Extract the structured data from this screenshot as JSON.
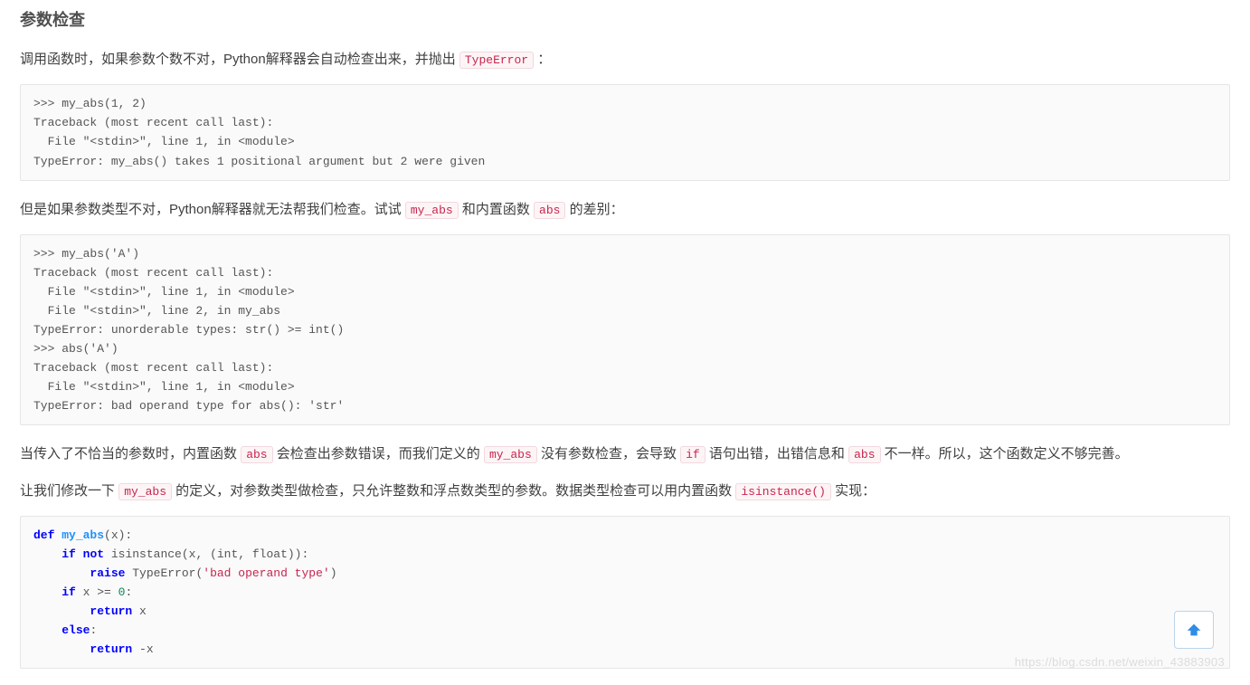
{
  "heading": "参数检查",
  "para1": {
    "t1": "调用函数时，如果参数个数不对，Python解释器会自动检查出来，并抛出",
    "code": "TypeError",
    "t2": "："
  },
  "code1": ">>> my_abs(1, 2)\nTraceback (most recent call last):\n  File \"<stdin>\", line 1, in <module>\nTypeError: my_abs() takes 1 positional argument but 2 were given",
  "para2": {
    "t1": "但是如果参数类型不对，Python解释器就无法帮我们检查。试试",
    "c1": "my_abs",
    "t2": "和内置函数",
    "c2": "abs",
    "t3": "的差别："
  },
  "code2": ">>> my_abs('A')\nTraceback (most recent call last):\n  File \"<stdin>\", line 1, in <module>\n  File \"<stdin>\", line 2, in my_abs\nTypeError: unorderable types: str() >= int()\n>>> abs('A')\nTraceback (most recent call last):\n  File \"<stdin>\", line 1, in <module>\nTypeError: bad operand type for abs(): 'str'",
  "para3": {
    "t1": "当传入了不恰当的参数时，内置函数",
    "c1": "abs",
    "t2": "会检查出参数错误，而我们定义的",
    "c2": "my_abs",
    "t3": "没有参数检查，会导致",
    "c3": "if",
    "t4": "语句出错，出错信息和",
    "c4": "abs",
    "t5": "不一样。所以，这个函数定义不够完善。"
  },
  "para4": {
    "t1": "让我们修改一下",
    "c1": "my_abs",
    "t2": "的定义，对参数类型做检查，只允许整数和浮点数类型的参数。数据类型检查可以用内置函数",
    "c2": "isinstance()",
    "t3": "实现："
  },
  "code3": {
    "kw_def": "def",
    "fn_name": "my_abs",
    "sig": "(x):",
    "kw_if": "if",
    "kw_not": "not",
    "isinstance_call": " isinstance(x, (int, float)):",
    "kw_raise": "raise",
    "typeerr": " TypeError(",
    "str_bad": "'bad operand type'",
    "close_paren": ")",
    "kw_if2": "if",
    "cmp": " x >= ",
    "num_zero": "0",
    "colon": ":",
    "kw_return": "return",
    "ret_x": " x",
    "kw_else": "else",
    "colon2": ":",
    "kw_return2": "return",
    "ret_neg": " -x"
  },
  "watermark": "https://blog.csdn.net/weixin_43883903"
}
